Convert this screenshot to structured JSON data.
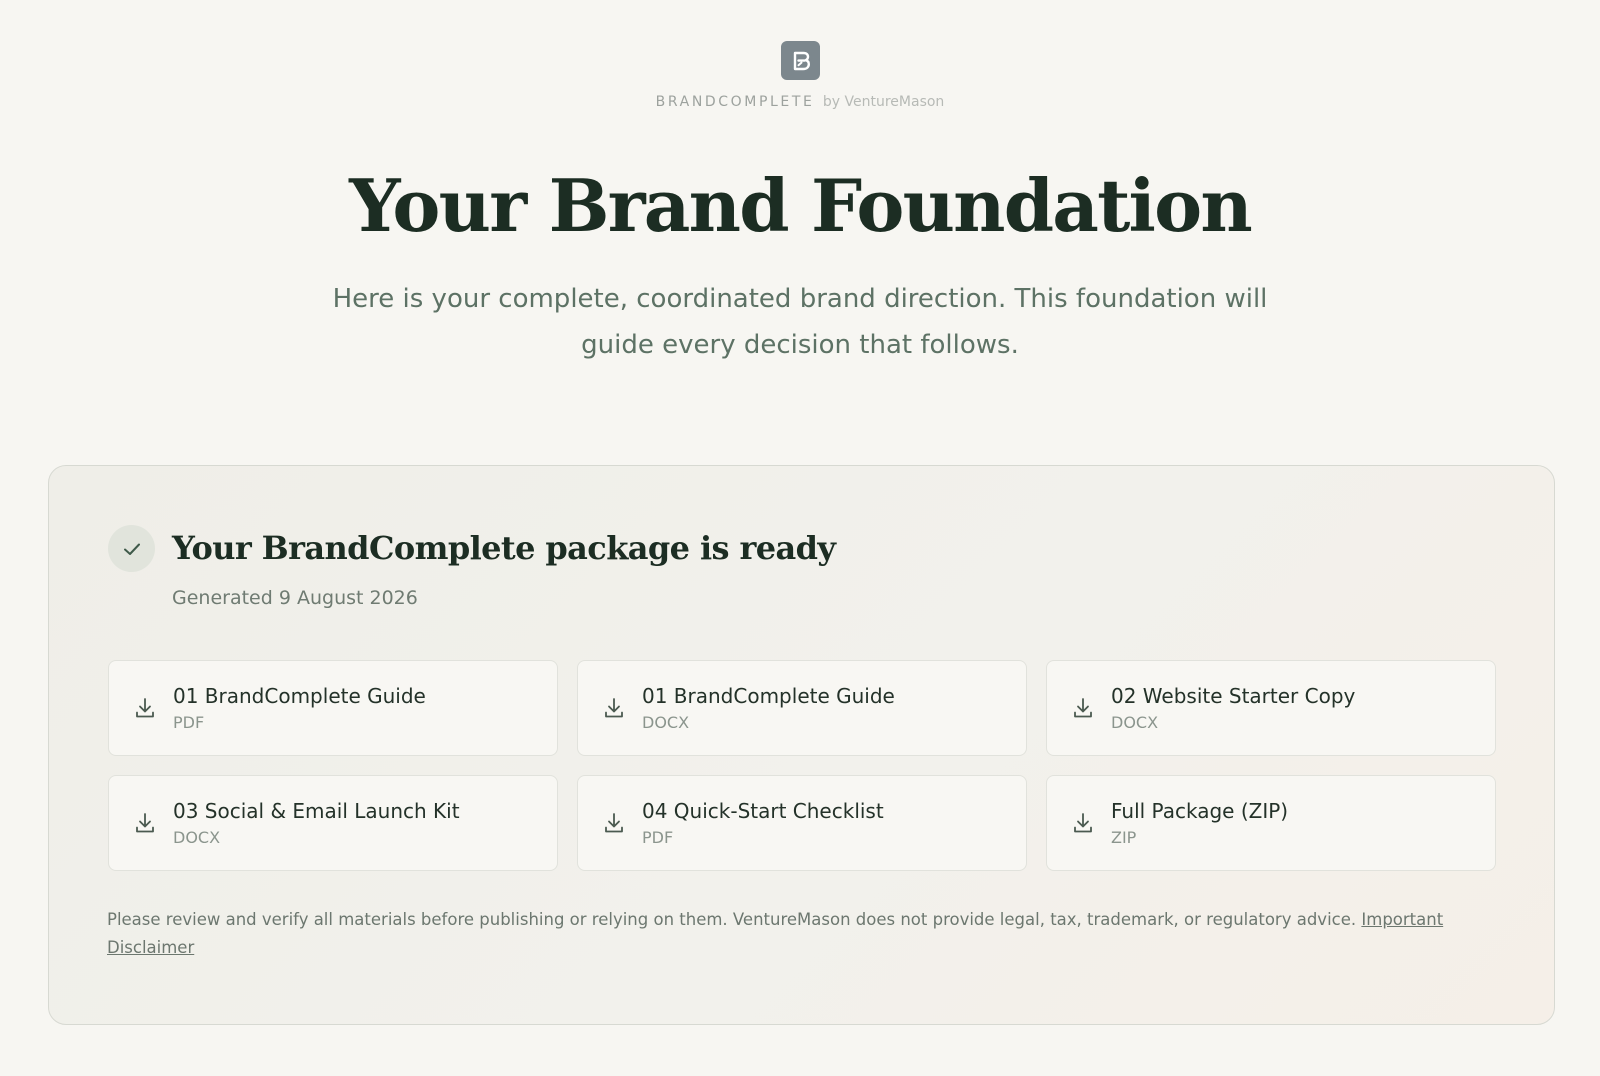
{
  "brand": {
    "name": "BRANDCOMPLETE",
    "byline": "by VentureMason",
    "logo_icon": "brand-b-logo"
  },
  "hero": {
    "title": "Your Brand Foundation",
    "subtitle": "Here is your complete, coordinated brand direction. This foundation will guide every decision that follows."
  },
  "package": {
    "status_icon": "checkmark-icon",
    "title": "Your BrandComplete package is ready",
    "generated": "Generated 9 August 2026",
    "files": [
      {
        "name": "01 BrandComplete Guide",
        "format": "PDF",
        "icon": "download-icon"
      },
      {
        "name": "01 BrandComplete Guide",
        "format": "DOCX",
        "icon": "download-icon"
      },
      {
        "name": "02 Website Starter Copy",
        "format": "DOCX",
        "icon": "download-icon"
      },
      {
        "name": "03 Social & Email Launch Kit",
        "format": "DOCX",
        "icon": "download-icon"
      },
      {
        "name": "04 Quick-Start Checklist",
        "format": "PDF",
        "icon": "download-icon"
      },
      {
        "name": "Full Package (ZIP)",
        "format": "ZIP",
        "icon": "download-icon"
      }
    ]
  },
  "disclaimer": {
    "text": "Please review and verify all materials before publishing or relying on them. VentureMason does not provide legal, tax, trademark, or regulatory advice.",
    "link_label": "Important Disclaimer"
  },
  "colors": {
    "background": "#f7f6f2",
    "heading": "#1c2d23",
    "subtitle": "#5d7265",
    "muted": "#6c776f",
    "logo": "#7c878d"
  }
}
